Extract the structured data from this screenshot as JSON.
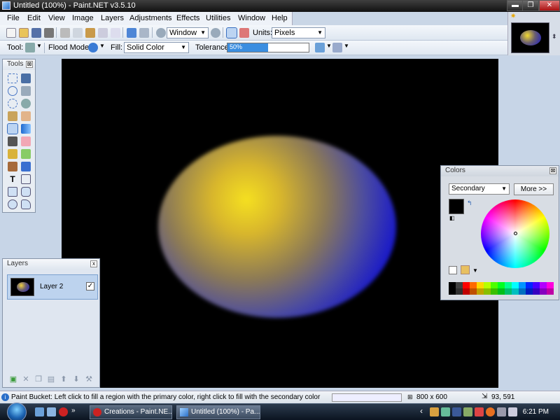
{
  "window": {
    "title": "Untitled (100%) - Paint.NET v3.5.10",
    "minimize": "▬",
    "maximize": "❐",
    "close": "✕"
  },
  "menu": [
    "File",
    "Edit",
    "View",
    "Image",
    "Layers",
    "Adjustments",
    "Effects",
    "Utilities",
    "Window",
    "Help"
  ],
  "toolbar1": {
    "zoom_value": "Window",
    "units_label": "Units:",
    "units_value": "Pixels"
  },
  "toolbar2": {
    "tool_label": "Tool:",
    "flood_mode_label": "Flood Mode:",
    "fill_label": "Fill:",
    "fill_value": "Solid Color",
    "tolerance_label": "Tolerance:",
    "tolerance_value": "50%",
    "tolerance_fraction": 0.5
  },
  "tools_panel": {
    "title": "Tools",
    "close": "⊠"
  },
  "layers_panel": {
    "title": "Layers",
    "close": "x",
    "layer_name": "Layer 2",
    "layer_checked": "✓"
  },
  "colors_panel": {
    "title": "Colors",
    "close": "⊠",
    "mode_value": "Secondary",
    "more_button": "More >>",
    "primary_color": "#000000",
    "secondary_color": "#000000"
  },
  "status": {
    "text": "Paint Bucket: Left click to fill a region with the primary color, right click to fill with the secondary color",
    "image_size": "800 x 600",
    "cursor_coords": "93, 591"
  },
  "taskbar": {
    "buttons": [
      "Creations - Paint.NE...",
      "Untitled (100%) - Pa..."
    ],
    "clock": "6:21 PM",
    "tray_arrow": "‹"
  },
  "palette_colors": [
    "#000000",
    "#404040",
    "#ff0000",
    "#ff6a00",
    "#ffd800",
    "#b6ff00",
    "#4cff00",
    "#00ff21",
    "#00ff90",
    "#00ffff",
    "#0094ff",
    "#0026ff",
    "#4800ff",
    "#b200ff",
    "#ff00dc"
  ]
}
